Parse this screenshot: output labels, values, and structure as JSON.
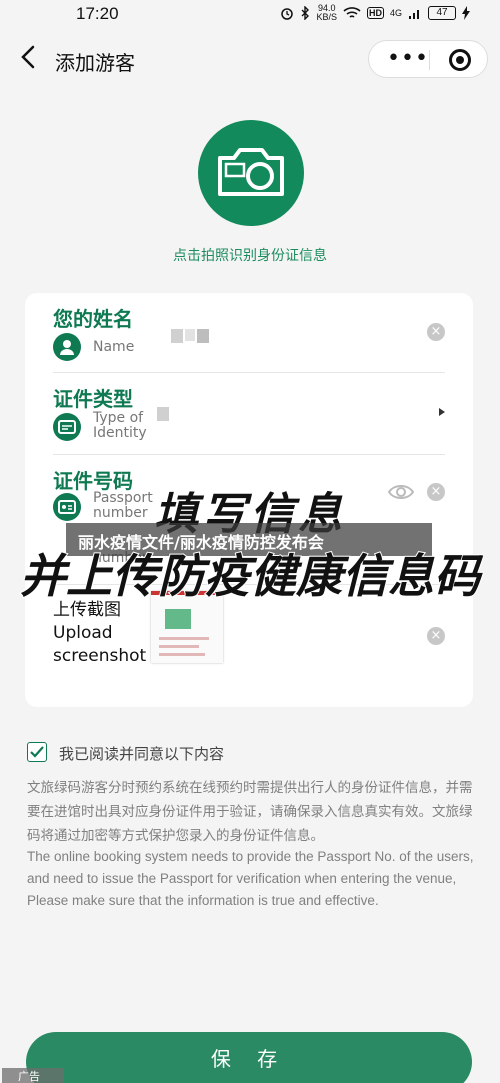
{
  "status": {
    "time": "17:20",
    "speed_value": "94.0",
    "speed_unit": "KB/S",
    "hd": "HD",
    "network": "4G",
    "battery": "47"
  },
  "nav": {
    "title": "添加游客",
    "more": "•••"
  },
  "camera": {
    "caption": "点击拍照识别身份证信息"
  },
  "form": {
    "name": {
      "title": "您的姓名",
      "sub": "Name"
    },
    "id_type": {
      "title": "证件类型",
      "sub_line1": "Type of",
      "sub_line2": "Identity"
    },
    "id_number": {
      "title": "证件号码",
      "sub_line1": "Passport",
      "sub_line2": "number"
    },
    "upload": {
      "line1": "上传截图",
      "line2": "Upload",
      "line3": "screenshot"
    },
    "clear_glyph": "×"
  },
  "agreement": {
    "label": "我已阅读并同意以下内容",
    "notice_cn": "文旅绿码游客分时预约系统在线预约时需提供出行人的身份证件信息，并需要在进馆时出具对应身份证件用于验证，请确保录入信息真实有效。文旅绿码将通过加密等方式保护您录入的身份证件信息。",
    "notice_en": "The online booking system needs to provide the Passport No. of the users, and need to issue the Passport for verification when entering the venue, Please make sure that the information is true and effective."
  },
  "save_button": "保 存",
  "overlay": {
    "title": "填写信息",
    "subtitle": "并上传防疫健康信息码",
    "banner": "丽水疫情文件/丽水疫情防控发布会",
    "corner_tag": "广告"
  },
  "colors": {
    "brand_green": "#138a5c",
    "button_green": "#2a8a63",
    "background": "#f4f4f4"
  },
  "icons": [
    "back-arrow-icon",
    "more-dots-icon",
    "close-circle-icon",
    "camera-icon",
    "person-icon",
    "id-card-icon",
    "passport-icon",
    "clear-icon",
    "eye-icon",
    "chevron-right-icon",
    "check-icon"
  ]
}
